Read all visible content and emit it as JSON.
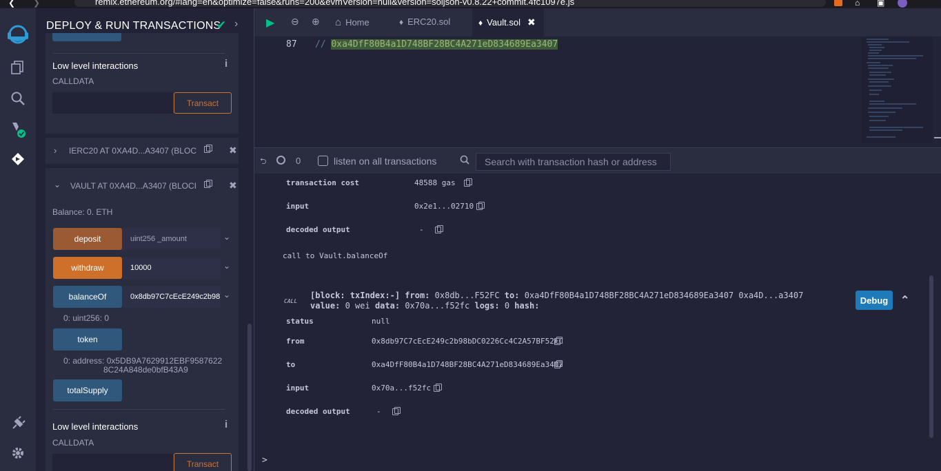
{
  "browser": {
    "url": "remix.ethereum.org/#lang=en&optimize=false&runs=200&evmVersion=null&version=soljson-v0.8.22+commit.4fc1097e.js"
  },
  "sidebar_icons": [
    "remix-logo-icon",
    "file-explorer-icon",
    "search-icon",
    "solidity-compiler-icon",
    "deploy-run-icon",
    "plugin-manager-icon",
    "settings-icon"
  ],
  "panel": {
    "title": "DEPLOY & RUN TRANSACTIONS",
    "low_level_1": {
      "title": "Low level interactions",
      "calldata": "CALLDATA",
      "transact": "Transact"
    },
    "ierc20": {
      "label": "IERC20 AT 0XA4D...A3407 (BLOC"
    },
    "vault": {
      "label": "VAULT AT 0XA4D...A3407 (BLOCI",
      "balance": "Balance: 0. ETH",
      "functions": {
        "deposit": {
          "label": "deposit",
          "placeholder": "uint256 _amount"
        },
        "withdraw": {
          "label": "withdraw",
          "value": "10000"
        },
        "balanceOf": {
          "label": "balanceOf",
          "value": "0x8db97C7cEcE249c2b98",
          "result": "0: uint256: 0"
        },
        "token": {
          "label": "token",
          "result_line1": "0: address: 0x5DB9A7629912EBF9587622",
          "result_line2": "8C24A848de0bfB43A9"
        },
        "totalSupply": {
          "label": "totalSupply"
        }
      }
    },
    "low_level_2": {
      "title": "Low level interactions",
      "calldata": "CALLDATA",
      "transact": "Transact"
    }
  },
  "tabs": {
    "home": "Home",
    "erc20": "ERC20.sol",
    "vault": "Vault.sol"
  },
  "editor": {
    "line_number": "87",
    "comment_prefix": "// ",
    "comment_address": "0xa4DfF80B4a1D748BF28BC4A271eD834689Ea3407"
  },
  "terminal_bar": {
    "count": "0",
    "listen_label": "listen on all transactions",
    "search_placeholder": "Search with transaction hash or address"
  },
  "tx1": {
    "cost_key": "transaction cost",
    "cost_val": "48588 gas",
    "input_key": "input",
    "input_val": "0x2e1...02710",
    "decoded_key": "decoded output",
    "decoded_val": "-"
  },
  "call_note": "call to Vault.balanceOf",
  "tx2": {
    "badge": "CALL",
    "line1_a": "[block: txIndex:-]",
    "line1_b": "from:",
    "line1_c": "0x8db...F52FC",
    "line1_d": "to:",
    "line1_e": "0xa4DfF80B4a1D748BF28BC4A271eD834689Ea3407 0xa4D...a3407",
    "line2_a": "value:",
    "line2_b": "0 wei",
    "line2_c": "data:",
    "line2_d": "0x70a...f52fc",
    "line2_e": "logs:",
    "line2_f": "0",
    "line2_g": "hash:",
    "debug": "Debug",
    "status_key": "status",
    "status_val": "null",
    "from_key": "from",
    "from_val": "0x8db97C7cEcE249c2b98bDC0226Cc4C2A57BF52FC",
    "to_key": "to",
    "to_val": "0xa4DfF80B4a1D748BF28BC4A271eD834689Ea3407",
    "input_key": "input",
    "input_val": "0x70a...f52fc",
    "decoded_key": "decoded output",
    "decoded_val": "-"
  },
  "prompt": ">",
  "colors": {
    "accent_orange": "#ce6f2a",
    "accent_blue": "#30587c",
    "success": "#00c08a",
    "debug_blue": "#1e7ab8"
  }
}
